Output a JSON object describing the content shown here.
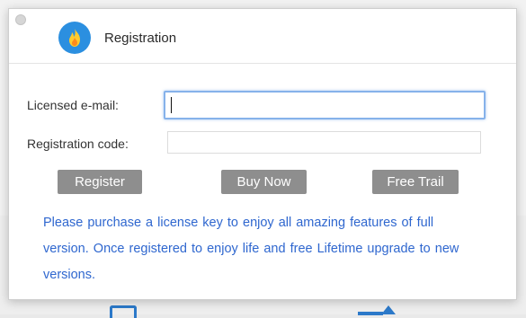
{
  "dialog": {
    "title": "Registration",
    "icon": "flame-icon",
    "accent_color": "#2b8fe0"
  },
  "form": {
    "email_label": "Licensed e-mail:",
    "email_value": "",
    "code_label": "Registration code:",
    "code_value": ""
  },
  "buttons": {
    "register": "Register",
    "buy_now": "Buy Now",
    "free_trial": "Free Trail"
  },
  "info_text": "Please purchase a license key to enjoy all amazing features of full version. Once registered to enjoy life and free Lifetime upgrade to new versions.",
  "colors": {
    "info_text": "#2f67cf",
    "button_bg": "#8e8e8e",
    "focus_border": "#86b2ea"
  }
}
